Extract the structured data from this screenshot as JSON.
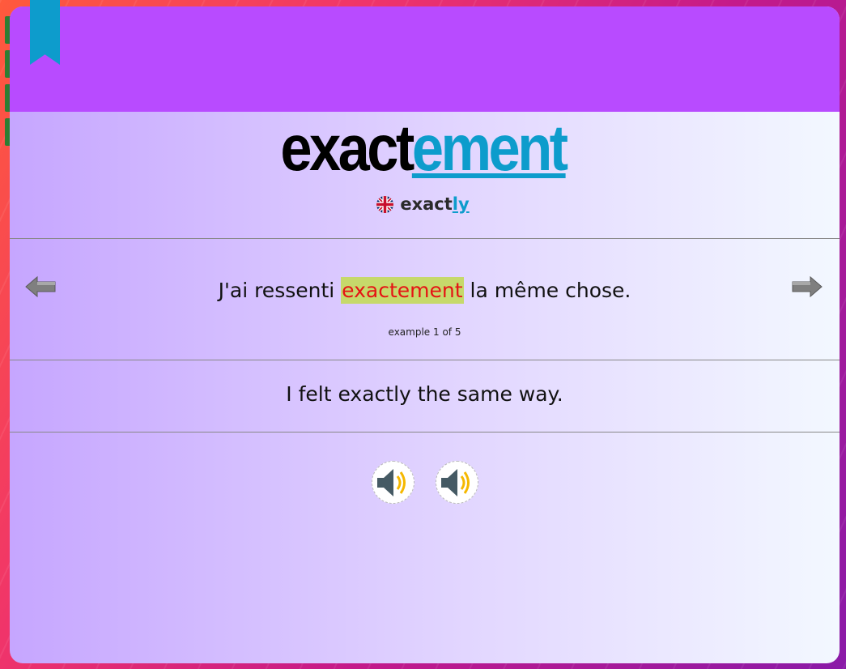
{
  "word": {
    "stem": "exact",
    "ending": "ement"
  },
  "translation": {
    "flag_icon": "uk-flag-icon",
    "stem": "exact",
    "ending": "ly"
  },
  "example": {
    "before": "J'ai ressenti ",
    "highlight": "exactement",
    "after": " la même chose.",
    "counter": "example 1 of 5"
  },
  "english_sentence": "I felt exactly the same way.",
  "controls": {
    "prev_icon": "arrow-left-icon",
    "next_icon": "arrow-right-icon",
    "audio_icon": "speaker-icon"
  },
  "colors": {
    "header": "#b84bff",
    "accent": "#0d9ccc",
    "highlight_bg": "#c6d96b",
    "highlight_text": "#e51414"
  }
}
